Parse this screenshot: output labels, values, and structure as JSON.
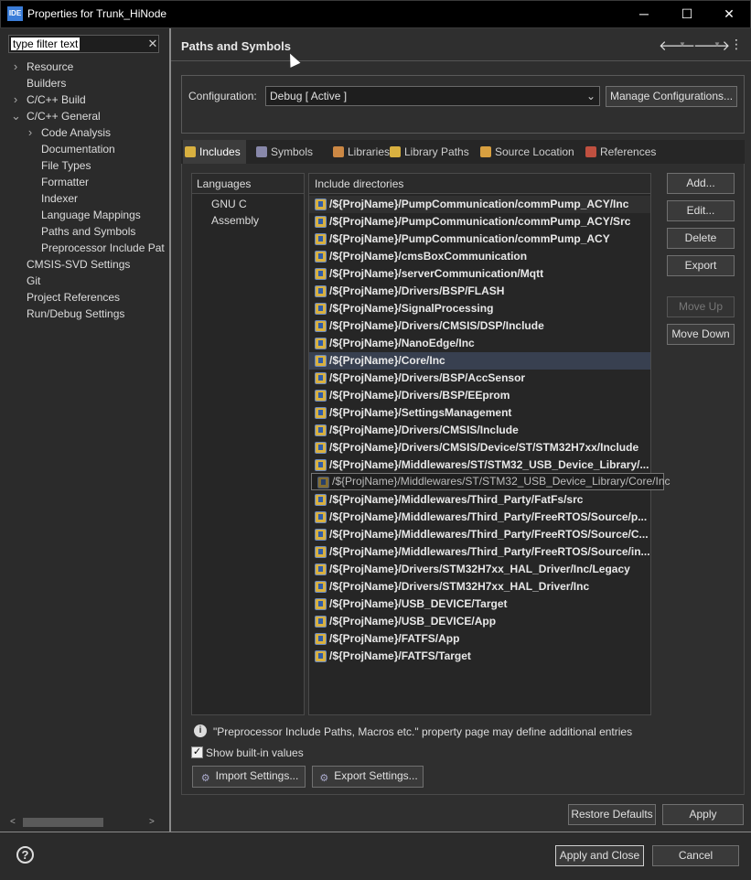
{
  "window": {
    "title": "Properties for Trunk_HiNode",
    "app_icon": "IDE"
  },
  "filter": {
    "value": "type filter text"
  },
  "tree": [
    {
      "label": "Resource",
      "indent": 0,
      "twisty": ">"
    },
    {
      "label": "Builders",
      "indent": 0,
      "twisty": ""
    },
    {
      "label": "C/C++ Build",
      "indent": 0,
      "twisty": ">"
    },
    {
      "label": "C/C++ General",
      "indent": 0,
      "twisty": "v"
    },
    {
      "label": "Code Analysis",
      "indent": 1,
      "twisty": ">"
    },
    {
      "label": "Documentation",
      "indent": 1,
      "twisty": ""
    },
    {
      "label": "File Types",
      "indent": 1,
      "twisty": ""
    },
    {
      "label": "Formatter",
      "indent": 1,
      "twisty": ""
    },
    {
      "label": "Indexer",
      "indent": 1,
      "twisty": ""
    },
    {
      "label": "Language Mappings",
      "indent": 1,
      "twisty": ""
    },
    {
      "label": "Paths and Symbols",
      "indent": 1,
      "twisty": ""
    },
    {
      "label": "Preprocessor Include Pat",
      "indent": 1,
      "twisty": ""
    },
    {
      "label": "CMSIS-SVD Settings",
      "indent": 0,
      "twisty": ""
    },
    {
      "label": "Git",
      "indent": 0,
      "twisty": ""
    },
    {
      "label": "Project References",
      "indent": 0,
      "twisty": ""
    },
    {
      "label": "Run/Debug Settings",
      "indent": 0,
      "twisty": ""
    }
  ],
  "page": {
    "title": "Paths and Symbols"
  },
  "config": {
    "label": "Configuration:",
    "value": "Debug  [ Active ]",
    "manage_label": "Manage Configurations..."
  },
  "tabs": [
    {
      "label": "Includes",
      "color": "#d8b040"
    },
    {
      "label": "Symbols",
      "color": "#8888aa"
    },
    {
      "label": "Libraries",
      "color": "#cc8844"
    },
    {
      "label": "Library Paths",
      "color": "#d8b040"
    },
    {
      "label": "Source Location",
      "color": "#d8a040"
    },
    {
      "label": "References",
      "color": "#c05040"
    }
  ],
  "languages": {
    "header": "Languages",
    "items": [
      "GNU C",
      "Assembly"
    ]
  },
  "includes": {
    "header": "Include directories",
    "items": [
      "/${ProjName}/PumpCommunication/commPump_ACY/Inc",
      "/${ProjName}/PumpCommunication/commPump_ACY/Src",
      "/${ProjName}/PumpCommunication/commPump_ACY",
      "/${ProjName}/cmsBoxCommunication",
      "/${ProjName}/serverCommunication/Mqtt",
      "/${ProjName}/Drivers/BSP/FLASH",
      "/${ProjName}/SignalProcessing",
      "/${ProjName}/Drivers/CMSIS/DSP/Include",
      "/${ProjName}/NanoEdge/Inc",
      "/${ProjName}/Core/Inc",
      "/${ProjName}/Drivers/BSP/AccSensor",
      "/${ProjName}/Drivers/BSP/EEprom",
      "/${ProjName}/SettingsManagement",
      "/${ProjName}/Drivers/CMSIS/Include",
      "/${ProjName}/Drivers/CMSIS/Device/ST/STM32H7xx/Include",
      "/${ProjName}/Middlewares/ST/STM32_USB_Device_Library/...",
      "/${ProjName}/Middlewares/ST/STM32_USB_Device_Library/Core/Inc",
      "/${ProjName}/Middlewares/Third_Party/FatFs/src",
      "/${ProjName}/Middlewares/Third_Party/FreeRTOS/Source/p...",
      "/${ProjName}/Middlewares/Third_Party/FreeRTOS/Source/C...",
      "/${ProjName}/Middlewares/Third_Party/FreeRTOS/Source/in...",
      "/${ProjName}/Drivers/STM32H7xx_HAL_Driver/Inc/Legacy",
      "/${ProjName}/Drivers/STM32H7xx_HAL_Driver/Inc",
      "/${ProjName}/USB_DEVICE/Target",
      "/${ProjName}/USB_DEVICE/App",
      "/${ProjName}/FATFS/App",
      "/${ProjName}/FATFS/Target"
    ],
    "tooltip": "/${ProjName}/Middlewares/ST/STM32_USB_Device_Library/Core/Inc"
  },
  "side_buttons": {
    "add": "Add...",
    "edit": "Edit...",
    "delete": "Delete",
    "export": "Export",
    "move_up": "Move Up",
    "move_down": "Move Down"
  },
  "info": {
    "text": "\"Preprocessor Include Paths, Macros etc.\" property page may define additional entries"
  },
  "show_builtin": {
    "label": "Show built-in values",
    "checked": true
  },
  "settings": {
    "import": "Import Settings...",
    "export": "Export Settings..."
  },
  "footer": {
    "restore": "Restore Defaults",
    "apply": "Apply",
    "apply_close": "Apply and Close",
    "cancel": "Cancel"
  }
}
